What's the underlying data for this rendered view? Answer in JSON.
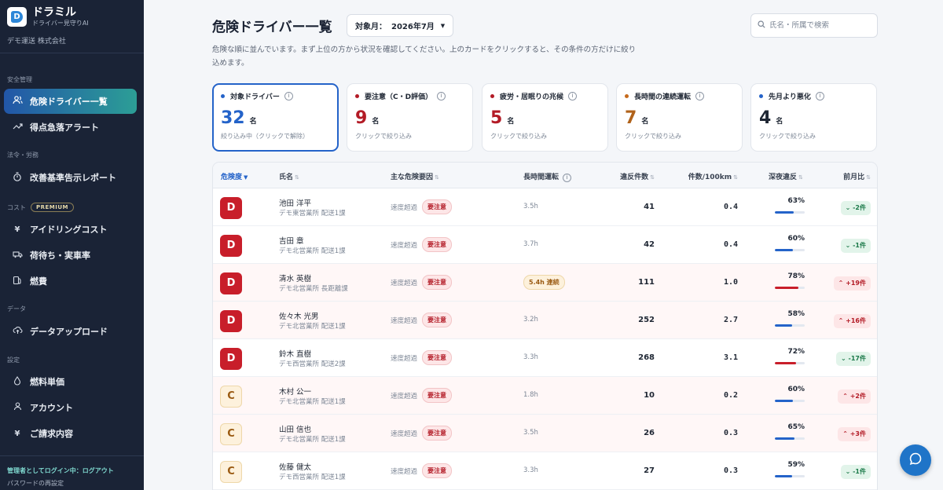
{
  "app": {
    "name": "ドラミル",
    "tagline": "ドライバー見守りAI",
    "company": "デモ運送 株式会社"
  },
  "sidebar": {
    "sections": [
      {
        "label": "安全管理",
        "premium": ""
      },
      {
        "label": "法令・労務",
        "premium": ""
      },
      {
        "label": "コスト",
        "premium": "PREMIUM"
      },
      {
        "label": "データ",
        "premium": ""
      },
      {
        "label": "設定",
        "premium": ""
      }
    ],
    "items": [
      {
        "label": "危険ドライバー一覧",
        "icon": "users-icon",
        "active": true
      },
      {
        "label": "得点急落アラート",
        "icon": "trend-icon",
        "active": false
      },
      {
        "label": "改善基準告示レポート",
        "icon": "timer-icon",
        "active": false
      },
      {
        "label": "アイドリングコスト",
        "icon": "yen-icon",
        "active": false
      },
      {
        "label": "荷待ち・実車率",
        "icon": "truck-icon",
        "active": false
      },
      {
        "label": "燃費",
        "icon": "fuel-icon",
        "active": false
      },
      {
        "label": "データアップロード",
        "icon": "cloud-upload-icon",
        "active": false
      },
      {
        "label": "燃料単価",
        "icon": "drop-icon",
        "active": false
      },
      {
        "label": "アカウント",
        "icon": "user-icon",
        "active": false
      },
      {
        "label": "ご請求内容",
        "icon": "yen-icon",
        "active": false
      }
    ],
    "footer_login": "管理者としてログイン中：ログアウト",
    "footer_password": "パスワードの再設定"
  },
  "header": {
    "title": "危険ドライバー一覧",
    "month_label": "対象月：",
    "month_value": "2026年7月",
    "search_placeholder": "氏名・所属で検索",
    "description": "危険な順に並んでいます。まず上位の方から状況を確認してください。上のカードをクリックすると、その条件の方だけに絞り込めます。"
  },
  "cards": [
    {
      "title": "対象ドライバー",
      "value": "32",
      "unit": "名",
      "hint": "絞り込み中（クリックで解除）",
      "color": "#2463c9",
      "dot": "#2463c9",
      "selected": true
    },
    {
      "title": "要注意（C・D評価）",
      "value": "9",
      "unit": "名",
      "hint": "クリックで絞り込み",
      "color": "#b31b26",
      "dot": "#b31b26",
      "selected": false
    },
    {
      "title": "疲労・居眠りの兆候",
      "value": "5",
      "unit": "名",
      "hint": "クリックで絞り込み",
      "color": "#b31b26",
      "dot": "#b31b26",
      "selected": false
    },
    {
      "title": "長時間の連続運転",
      "value": "7",
      "unit": "名",
      "hint": "クリックで絞り込み",
      "color": "#b0621a",
      "dot": "#c66a1c",
      "selected": false
    },
    {
      "title": "先月より悪化",
      "value": "4",
      "unit": "名",
      "hint": "クリックで絞り込み",
      "color": "#1e2633",
      "dot": "#2463c9",
      "selected": false
    }
  ],
  "table": {
    "columns": {
      "risk": "危険度",
      "name": "氏名",
      "factor": "主な危険要因",
      "long_drive": "長時間運転",
      "violations": "違反件数",
      "per100": "件数/100km",
      "night": "深夜違反",
      "mom": "前月比"
    },
    "rows": [
      {
        "grade": "D",
        "name": "池田 洋平",
        "office": "デモ東営業所 配送1課",
        "factor": "速度超過",
        "factor_tag": "要注意",
        "long": "3.5h",
        "long_alert": false,
        "violations": "41",
        "per100": "0.4",
        "night": "63%",
        "night_value": 63,
        "mom": "-2件",
        "mom_dir": "down"
      },
      {
        "grade": "D",
        "name": "吉田 章",
        "office": "デモ北営業所 配送1課",
        "factor": "速度超過",
        "factor_tag": "要注意",
        "long": "3.7h",
        "long_alert": false,
        "violations": "42",
        "per100": "0.4",
        "night": "60%",
        "night_value": 60,
        "mom": "-1件",
        "mom_dir": "down"
      },
      {
        "grade": "D",
        "name": "清水 英樹",
        "office": "デモ北営業所 長距離課",
        "factor": "速度超過",
        "factor_tag": "要注意",
        "long": "5.4h 連続",
        "long_alert": true,
        "violations": "111",
        "per100": "1.0",
        "night": "78%",
        "night_value": 78,
        "mom": "+19件",
        "mom_dir": "up"
      },
      {
        "grade": "D",
        "name": "佐々木 光男",
        "office": "デモ北営業所 配送1課",
        "factor": "速度超過",
        "factor_tag": "要注意",
        "long": "3.2h",
        "long_alert": false,
        "violations": "252",
        "per100": "2.7",
        "night": "58%",
        "night_value": 58,
        "mom": "+16件",
        "mom_dir": "up"
      },
      {
        "grade": "D",
        "name": "鈴木 直樹",
        "office": "デモ西営業所 配送2課",
        "factor": "速度超過",
        "factor_tag": "要注意",
        "long": "3.3h",
        "long_alert": false,
        "violations": "268",
        "per100": "3.1",
        "night": "72%",
        "night_value": 72,
        "mom": "-17件",
        "mom_dir": "down"
      },
      {
        "grade": "C",
        "name": "木村 公一",
        "office": "デモ北営業所 配送1課",
        "factor": "速度超過",
        "factor_tag": "要注意",
        "long": "1.8h",
        "long_alert": false,
        "violations": "10",
        "per100": "0.2",
        "night": "60%",
        "night_value": 60,
        "mom": "+2件",
        "mom_dir": "up"
      },
      {
        "grade": "C",
        "name": "山田 信也",
        "office": "デモ北営業所 配送1課",
        "factor": "速度超過",
        "factor_tag": "要注意",
        "long": "3.5h",
        "long_alert": false,
        "violations": "26",
        "per100": "0.3",
        "night": "65%",
        "night_value": 65,
        "mom": "+3件",
        "mom_dir": "up"
      },
      {
        "grade": "C",
        "name": "佐藤 健太",
        "office": "デモ西営業所 配送1課",
        "factor": "速度超過",
        "factor_tag": "要注意",
        "long": "3.3h",
        "long_alert": false,
        "violations": "27",
        "per100": "0.3",
        "night": "59%",
        "night_value": 59,
        "mom": "-1件",
        "mom_dir": "down"
      }
    ]
  },
  "colors": {
    "night_normal": "#2463c9",
    "night_high": "#c81e2a"
  }
}
